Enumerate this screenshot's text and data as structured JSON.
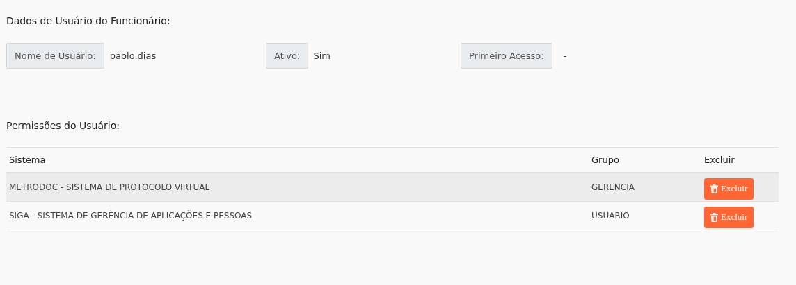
{
  "user_section": {
    "title": "Dados de Usuário do Funcionário:",
    "fields": [
      {
        "label": "Nome de Usuário:",
        "value": "pablo.dias"
      },
      {
        "label": "Ativo:",
        "value": "Sim"
      },
      {
        "label": "Primeiro Acesso:",
        "value": "-"
      }
    ]
  },
  "permissions": {
    "title": "Permissões do Usuário:",
    "columns": [
      "Sistema",
      "Grupo",
      "Excluir"
    ],
    "rows": [
      {
        "system": "METRODOC - SISTEMA DE PROTOCOLO VIRTUAL",
        "group": "GERENCIA",
        "action": "Excluir",
        "highlighted": true
      },
      {
        "system": "SIGA - SISTEMA DE GERÊNCIA DE APLICAÇÕES E PESSOAS",
        "group": "USUARIO",
        "action": "Excluir",
        "highlighted": false
      }
    ]
  }
}
